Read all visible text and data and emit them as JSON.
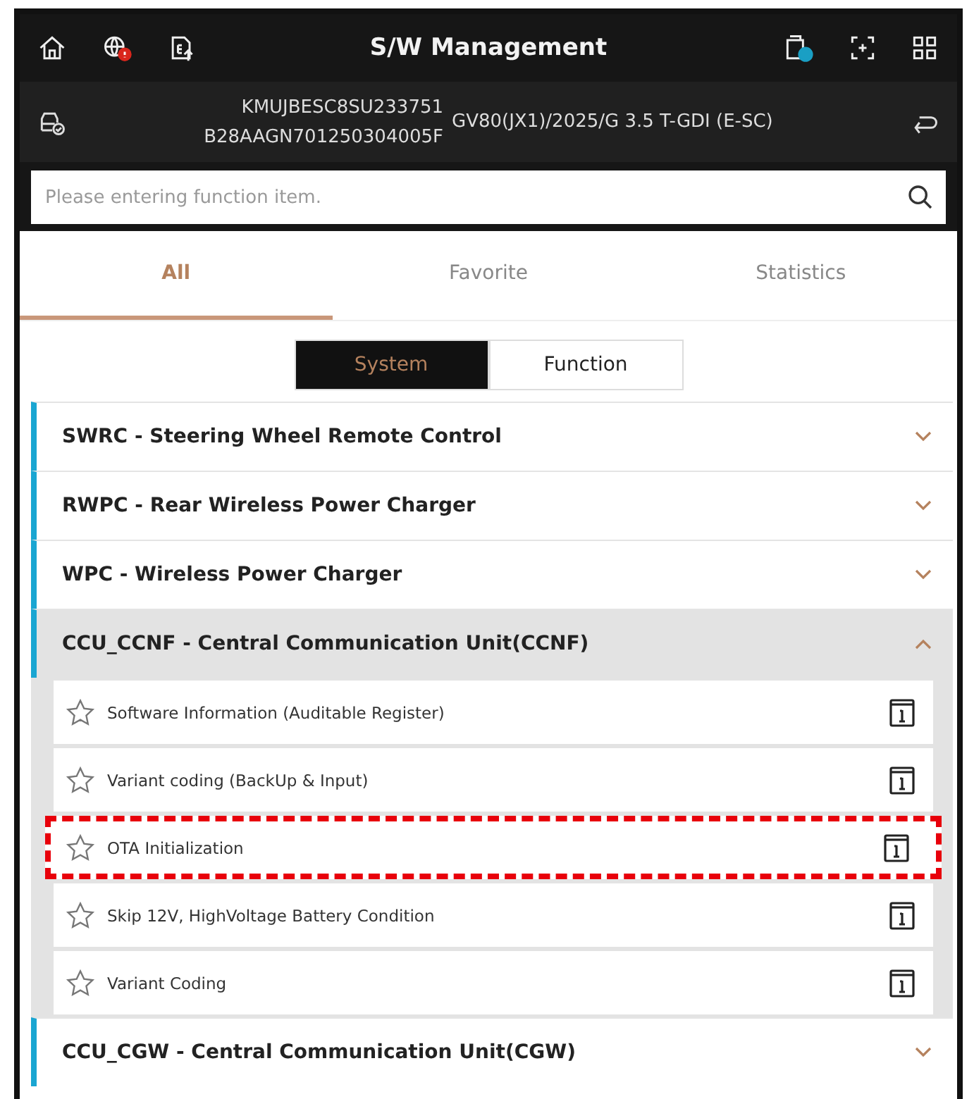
{
  "header": {
    "title": "S/W Management"
  },
  "vehicle": {
    "vin": "KMUJBESC8SU233751",
    "id": "B28AAGN701250304005F",
    "model": "GV80(JX1)/2025/G 3.5 T-GDI (E-SC)"
  },
  "search": {
    "placeholder": "Please entering function item."
  },
  "tabs": [
    {
      "label": "All",
      "selected": true
    },
    {
      "label": "Favorite",
      "selected": false
    },
    {
      "label": "Statistics",
      "selected": false
    }
  ],
  "segments": [
    {
      "label": "System",
      "selected": true
    },
    {
      "label": "Function",
      "selected": false
    }
  ],
  "groups": [
    {
      "title": "SWRC - Steering Wheel Remote Control",
      "expanded": false
    },
    {
      "title": "RWPC - Rear Wireless Power Charger",
      "expanded": false
    },
    {
      "title": "WPC - Wireless Power Charger",
      "expanded": false
    },
    {
      "title": "CCU_CCNF - Central Communication Unit(CCNF)",
      "expanded": true,
      "items": [
        {
          "label": "Software Information (Auditable Register)",
          "favorite": false,
          "highlighted": false
        },
        {
          "label": "Variant coding (BackUp & Input)",
          "favorite": false,
          "highlighted": false
        },
        {
          "label": "OTA Initialization",
          "favorite": false,
          "highlighted": true
        },
        {
          "label": "Skip 12V, HighVoltage Battery Condition",
          "favorite": false,
          "highlighted": false
        },
        {
          "label": "Variant Coding",
          "favorite": false,
          "highlighted": false
        }
      ]
    },
    {
      "title": "CCU_CGW - Central Communication Unit(CGW)",
      "expanded": false
    }
  ]
}
